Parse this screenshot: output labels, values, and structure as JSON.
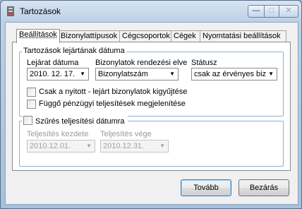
{
  "window": {
    "title": "Tartozások",
    "minimize": "—",
    "maximize": "□",
    "close": "✕"
  },
  "tabs": [
    {
      "label": "Beállítások",
      "active": true
    },
    {
      "label": "Bizonylattípusok"
    },
    {
      "label": "Cégcsoportok"
    },
    {
      "label": "Cégek"
    },
    {
      "label": "Nyomtatási beállítások"
    }
  ],
  "due_group": {
    "legend": "Tartozások lejártának dátuma",
    "due_date_label": "Lejárat dátuma",
    "due_date_value": "2010. 12. 17.",
    "sort_label": "Bizonylatok rendezési elve",
    "sort_value": "Bizonylatszám",
    "status_label": "Státusz",
    "status_value": "csak az érvényes biz",
    "check_open_expired": "Csak a nyitott - lejárt bizonylatok kigyűjtése",
    "check_pending": "Függő pénzügyi teljesítések megjelenítése"
  },
  "filter_group": {
    "legend": "Szűrés teljesítési dátumra",
    "start_label": "Teljesítés kezdete",
    "start_value": "2010.12.01.",
    "end_label": "Teljesítés vége",
    "end_value": "2010.12.31."
  },
  "buttons": {
    "next": "Tovább",
    "close": "Bezárás"
  }
}
